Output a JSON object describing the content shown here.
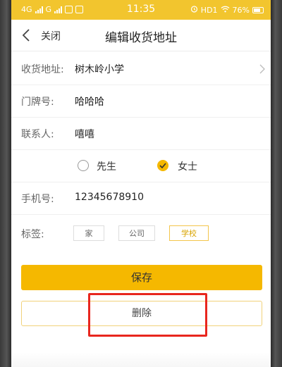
{
  "status_bar": {
    "network_1": "4G",
    "network_2": "G",
    "time": "11:35",
    "hd_label": "HD1",
    "battery": "76%"
  },
  "header": {
    "close_label": "关闭",
    "title": "编辑收货地址"
  },
  "form": {
    "address_label": "收货地址:",
    "address_value": "树木岭小学",
    "door_label": "门牌号:",
    "door_value": "哈哈哈",
    "contact_label": "联系人:",
    "contact_value": "嘻嘻",
    "gender_options": [
      "先生",
      "女士"
    ],
    "gender_selected": "女士",
    "phone_label": "手机号:",
    "phone_value": "12345678910",
    "tags_label": "标签:",
    "tags": [
      "家",
      "公司",
      "学校"
    ],
    "tag_selected": "学校"
  },
  "actions": {
    "save_label": "保存",
    "delete_label": "删除"
  },
  "colors": {
    "accent": "#f5b800",
    "highlight": "#e8261e"
  }
}
